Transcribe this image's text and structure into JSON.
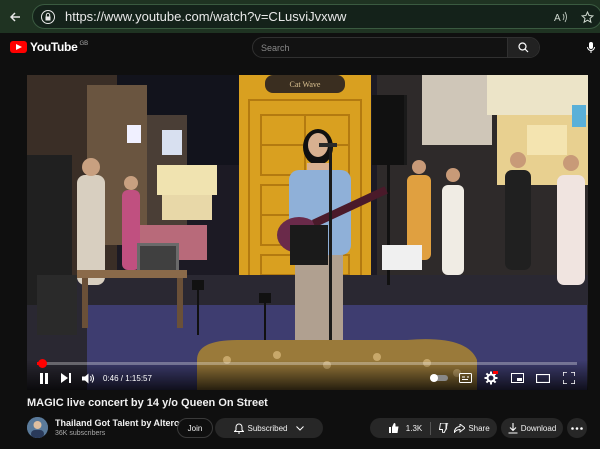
{
  "browser": {
    "url_prefix": "https://",
    "url_host": "www.youtube.com",
    "url_path": "/watch?v=CLusviJvxww"
  },
  "header": {
    "logo_text": "YouTube",
    "region": "GB",
    "search_placeholder": "Search"
  },
  "player": {
    "current_time": "0:46",
    "duration": "1:15:57",
    "progress_fraction": 0.01
  },
  "video": {
    "title": "MAGIC live concert by 14 y/o Queen On Street",
    "stage_sign": "Cat Wave"
  },
  "channel": {
    "name": "Thailand Got Talent by Altero",
    "subscribers": "36K subscribers"
  },
  "actions": {
    "join": "Join",
    "subscribed": "Subscribed",
    "likes": "1.3K",
    "share": "Share",
    "download": "Download"
  },
  "colors": {
    "accent": "#ff0000",
    "browser_bar": "#1f3322",
    "page_bg": "#0f0f0f"
  }
}
